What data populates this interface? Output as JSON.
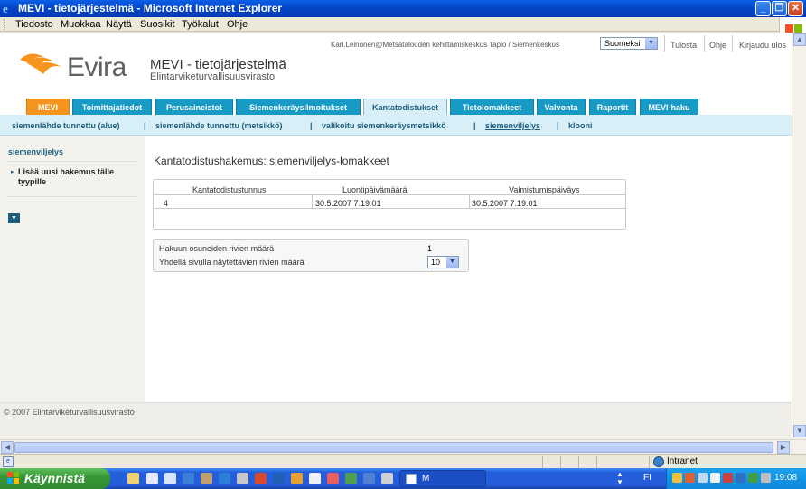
{
  "window": {
    "title": "MEVI - tietojärjestelmä - Microsoft Internet Explorer"
  },
  "menubar": {
    "items": [
      "Tiedosto",
      "Muokkaa",
      "Näytä",
      "Suosikit",
      "Työkalut",
      "Ohje"
    ]
  },
  "header": {
    "user_line": "Kari.Leinonen@Metsätalouden kehittämiskeskus Tapio / Siemenkeskus",
    "language_selected": "Suomeksi",
    "links": [
      "Tulosta",
      "Ohje",
      "Kirjaudu ulos"
    ],
    "logo_text": "Evira",
    "app_title": "MEVI - tietojärjestelmä",
    "app_subtitle": "Elintarviketurvallisuusvirasto"
  },
  "tabs": [
    {
      "label": "MEVI",
      "style": "orange"
    },
    {
      "label": "Toimittajatiedot",
      "style": "normal"
    },
    {
      "label": "Perusaineistot",
      "style": "normal"
    },
    {
      "label": "Siemenkeräysilmoitukset",
      "style": "normal"
    },
    {
      "label": "Kantatodistukset",
      "style": "active"
    },
    {
      "label": "Tietolomakkeet",
      "style": "normal"
    },
    {
      "label": "Valvonta",
      "style": "normal"
    },
    {
      "label": "Raportit",
      "style": "normal"
    },
    {
      "label": "MEVI-haku",
      "style": "normal"
    }
  ],
  "subnav": {
    "items": [
      "siemenlähde tunnettu (alue)",
      "siemenlähde tunnettu (metsikkö)",
      "valikoitu siemenkeräysmetsikkö",
      "siemenviljelys",
      "klooni"
    ],
    "current": "siemenviljelys",
    "separator": "|"
  },
  "sidebar": {
    "heading": "siemenviljelys",
    "link": "Lisää uusi hakemus tälle tyypille"
  },
  "main": {
    "title": "Kantatodistushakemus: siemenviljelys-lomakkeet",
    "table": {
      "headers": [
        "Kantatodistustunnus",
        "Luontipäivämäärä",
        "Valmistumispäiväys"
      ],
      "rows": [
        [
          "4",
          "30.5.2007 7:19:01",
          "30.5.2007 7:19:01"
        ]
      ]
    },
    "info": {
      "rows_label": "Hakuun osuneiden rivien määrä",
      "rows_value": "1",
      "per_page_label": "Yhdellä sivulla näytettävien rivien määrä",
      "per_page_value": "10"
    }
  },
  "footer": {
    "copyright": "© 2007 Elintarviketurvallisuusvirasto"
  },
  "statusbar": {
    "zone": "Intranet"
  },
  "taskbar": {
    "start_label": "Käynnistä",
    "task_label": "M",
    "language": "FI",
    "clock": "19:08"
  },
  "colors": {
    "tab_blue": "#179ac4",
    "tab_orange": "#f7941e",
    "tab_active_bg": "#d9eff7",
    "link_color": "#1b5f7f"
  }
}
